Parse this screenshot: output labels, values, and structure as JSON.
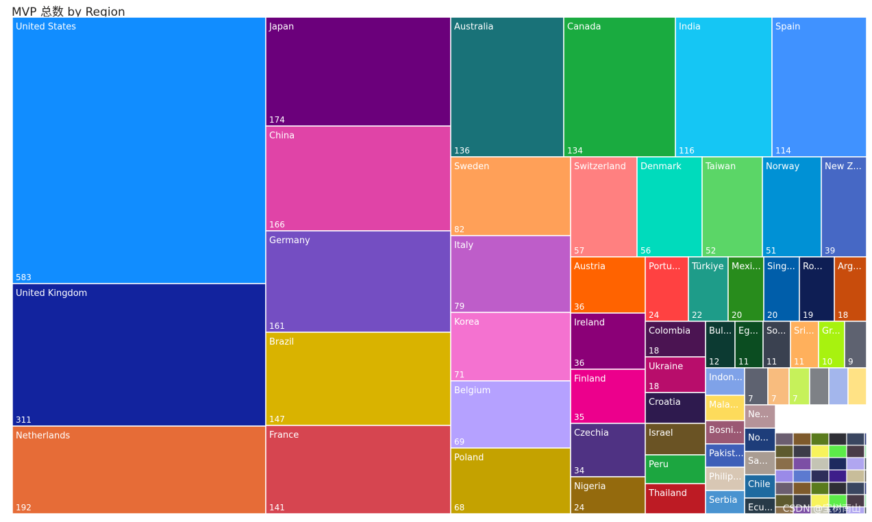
{
  "chart_data": {
    "type": "treemap",
    "title": "MVP 总数 by Region",
    "items": [
      {
        "name": "United States",
        "label": "United States",
        "value": 583,
        "color": "#118DFF"
      },
      {
        "name": "United Kingdom",
        "label": "United Kingdom",
        "value": 311,
        "color": "#12239E"
      },
      {
        "name": "Netherlands",
        "label": "Netherlands",
        "value": 192,
        "color": "#E66C37"
      },
      {
        "name": "Japan",
        "label": "Japan",
        "value": 174,
        "color": "#6B007B"
      },
      {
        "name": "China",
        "label": "China",
        "value": 166,
        "color": "#E044A7"
      },
      {
        "name": "Germany",
        "label": "Germany",
        "value": 161,
        "color": "#744EC2"
      },
      {
        "name": "Brazil",
        "label": "Brazil",
        "value": 147,
        "color": "#D9B300"
      },
      {
        "name": "France",
        "label": "France",
        "value": 141,
        "color": "#D64550"
      },
      {
        "name": "Australia",
        "label": "Australia",
        "value": 136,
        "color": "#197278"
      },
      {
        "name": "Canada",
        "label": "Canada",
        "value": 134,
        "color": "#1AAB40"
      },
      {
        "name": "India",
        "label": "India",
        "value": 116,
        "color": "#15C6F4"
      },
      {
        "name": "Spain",
        "label": "Spain",
        "value": 114,
        "color": "#4092FF"
      },
      {
        "name": "Sweden",
        "label": "Sweden",
        "value": 82,
        "color": "#FFA058"
      },
      {
        "name": "Italy",
        "label": "Italy",
        "value": 79,
        "color": "#BE5DC9"
      },
      {
        "name": "Korea",
        "label": "Korea",
        "value": 71,
        "color": "#F472D0"
      },
      {
        "name": "Belgium",
        "label": "Belgium",
        "value": 69,
        "color": "#B5A1FF"
      },
      {
        "name": "Poland",
        "label": "Poland",
        "value": 68,
        "color": "#C4A200"
      },
      {
        "name": "Switzerland",
        "label": "Switzerland",
        "value": 57,
        "color": "#FF8080"
      },
      {
        "name": "Denmark",
        "label": "Denmark",
        "value": 56,
        "color": "#00DBBC"
      },
      {
        "name": "Taiwan",
        "label": "Taiwan",
        "value": 52,
        "color": "#5BD667"
      },
      {
        "name": "Norway",
        "label": "Norway",
        "value": 51,
        "color": "#0091D5"
      },
      {
        "name": "New Zealand",
        "label": "New Z...",
        "value": 39,
        "color": "#4668C5"
      },
      {
        "name": "Austria",
        "label": "Austria",
        "value": 36,
        "color": "#FF6300"
      },
      {
        "name": "Portugal",
        "label": "Portu...",
        "value": 24,
        "color": "#FF4141"
      },
      {
        "name": "Türkiye",
        "label": "Türkiye",
        "value": 22,
        "color": "#1E9C89"
      },
      {
        "name": "Mexico",
        "label": "Mexi...",
        "value": 20,
        "color": "#288C1C"
      },
      {
        "name": "Singapore",
        "label": "Sing...",
        "value": 20,
        "color": "#005EAA"
      },
      {
        "name": "Romania",
        "label": "Ro...",
        "value": 19,
        "color": "#0E1E54"
      },
      {
        "name": "Argentina",
        "label": "Arg...",
        "value": 18,
        "color": "#C84C0C"
      },
      {
        "name": "Ireland",
        "label": "Ireland",
        "value": 36,
        "color": "#8B0077"
      },
      {
        "name": "Finland",
        "label": "Finland",
        "value": 35,
        "color": "#EC008C"
      },
      {
        "name": "Czechia",
        "label": "Czechia",
        "value": 34,
        "color": "#4F3283"
      },
      {
        "name": "Nigeria",
        "label": "Nigeria",
        "value": 24,
        "color": "#946A0D"
      },
      {
        "name": "Colombia",
        "label": "Colombia",
        "value": 18,
        "color": "#4B1452"
      },
      {
        "name": "Ukraine",
        "label": "Ukraine",
        "value": 18,
        "color": "#B80D6B"
      },
      {
        "name": "Croatia",
        "label": "Croatia",
        "value": null,
        "color": "#2E1A4E"
      },
      {
        "name": "Israel",
        "label": "Israel",
        "value": null,
        "color": "#6A5324"
      },
      {
        "name": "Peru",
        "label": "Peru",
        "value": null,
        "color": "#1CA640"
      },
      {
        "name": "Thailand",
        "label": "Thailand",
        "value": null,
        "color": "#BD1B24"
      },
      {
        "name": "Bulgaria",
        "label": "Bul...",
        "value": 12,
        "color": "#0C3A32"
      },
      {
        "name": "Egypt",
        "label": "Eg...",
        "value": 11,
        "color": "#0B4D21"
      },
      {
        "name": "South Africa",
        "label": "So...",
        "value": 11,
        "color": "#3A4150"
      },
      {
        "name": "Sri Lanka",
        "label": "Sri...",
        "value": 11,
        "color": "#FFB05C"
      },
      {
        "name": "Greece",
        "label": "Gr...",
        "value": 10,
        "color": "#A8F20F"
      },
      {
        "name": "Region-9",
        "label": "",
        "value": 9,
        "color": "#5E6270"
      },
      {
        "name": "Indonesia",
        "label": "Indon...",
        "value": null,
        "color": "#7FA2E8"
      },
      {
        "name": "Region-7a",
        "label": "",
        "value": 7,
        "color": "#5E6270"
      },
      {
        "name": "Region-7b",
        "label": "",
        "value": 7,
        "color": "#F8BC7E"
      },
      {
        "name": "Region-7c",
        "label": "",
        "value": 7,
        "color": "#C6F15A"
      },
      {
        "name": "Region-s1",
        "label": "",
        "value": null,
        "color": "#7E8186"
      },
      {
        "name": "Region-s2",
        "label": "",
        "value": null,
        "color": "#A3B6EC"
      },
      {
        "name": "Region-s3",
        "label": "",
        "value": null,
        "color": "#FFE285"
      },
      {
        "name": "Malaysia",
        "label": "Mala...",
        "value": null,
        "color": "#FDDB5B"
      },
      {
        "name": "Nepal",
        "label": "Ne...",
        "value": null,
        "color": "#B59399"
      },
      {
        "name": "Bosnia",
        "label": "Bosni...",
        "value": null,
        "color": "#9B5873"
      },
      {
        "name": "Norway-2",
        "label": "No...",
        "value": null,
        "color": "#1E3D7A"
      },
      {
        "name": "Pakistan",
        "label": "Pakist...",
        "value": null,
        "color": "#3E5FB8"
      },
      {
        "name": "Saudi Arabia",
        "label": "Sa...",
        "value": null,
        "color": "#A99C92"
      },
      {
        "name": "Philippines",
        "label": "Philip...",
        "value": null,
        "color": "#D8C7B4"
      },
      {
        "name": "Chile",
        "label": "Chile",
        "value": null,
        "color": "#1E6AA0"
      },
      {
        "name": "Serbia",
        "label": "Serbia",
        "value": null,
        "color": "#4993D0"
      },
      {
        "name": "Ecuador",
        "label": "Ecu...",
        "value": null,
        "color": "#273A48"
      }
    ]
  },
  "watermark": "CSDN @宝树南山"
}
